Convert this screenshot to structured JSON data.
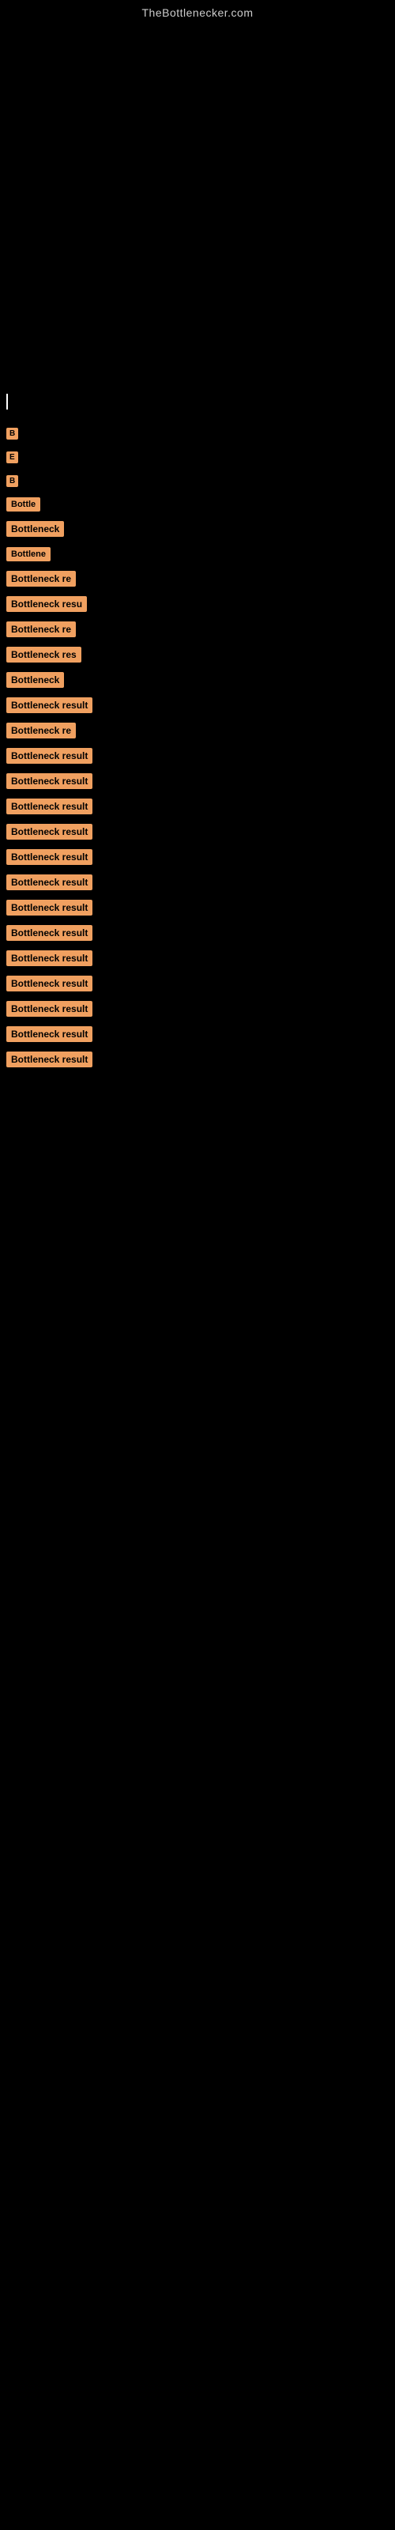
{
  "site": {
    "title": "TheBottlenecker.com"
  },
  "items": [
    {
      "id": 1,
      "label": "B",
      "size": "xs"
    },
    {
      "id": 2,
      "label": "E",
      "size": "xs"
    },
    {
      "id": 3,
      "label": "B",
      "size": "xs"
    },
    {
      "id": 4,
      "label": "Bottle",
      "size": "sm"
    },
    {
      "id": 5,
      "label": "Bottleneck",
      "size": "md"
    },
    {
      "id": 6,
      "label": "Bottlene",
      "size": "sm"
    },
    {
      "id": 7,
      "label": "Bottleneck re",
      "size": "md"
    },
    {
      "id": 8,
      "label": "Bottleneck resu",
      "size": "lg"
    },
    {
      "id": 9,
      "label": "Bottleneck re",
      "size": "md"
    },
    {
      "id": 10,
      "label": "Bottleneck res",
      "size": "md"
    },
    {
      "id": 11,
      "label": "Bottleneck",
      "size": "md"
    },
    {
      "id": 12,
      "label": "Bottleneck result",
      "size": "lg"
    },
    {
      "id": 13,
      "label": "Bottleneck re",
      "size": "md"
    },
    {
      "id": 14,
      "label": "Bottleneck result",
      "size": "lg"
    },
    {
      "id": 15,
      "label": "Bottleneck result",
      "size": "lg"
    },
    {
      "id": 16,
      "label": "Bottleneck result",
      "size": "lg"
    },
    {
      "id": 17,
      "label": "Bottleneck result",
      "size": "lg"
    },
    {
      "id": 18,
      "label": "Bottleneck result",
      "size": "lg"
    },
    {
      "id": 19,
      "label": "Bottleneck result",
      "size": "lg"
    },
    {
      "id": 20,
      "label": "Bottleneck result",
      "size": "lg"
    },
    {
      "id": 21,
      "label": "Bottleneck result",
      "size": "lg"
    },
    {
      "id": 22,
      "label": "Bottleneck result",
      "size": "lg"
    },
    {
      "id": 23,
      "label": "Bottleneck result",
      "size": "lg"
    },
    {
      "id": 24,
      "label": "Bottleneck result",
      "size": "lg"
    },
    {
      "id": 25,
      "label": "Bottleneck result",
      "size": "lg"
    },
    {
      "id": 26,
      "label": "Bottleneck result",
      "size": "lg"
    }
  ]
}
